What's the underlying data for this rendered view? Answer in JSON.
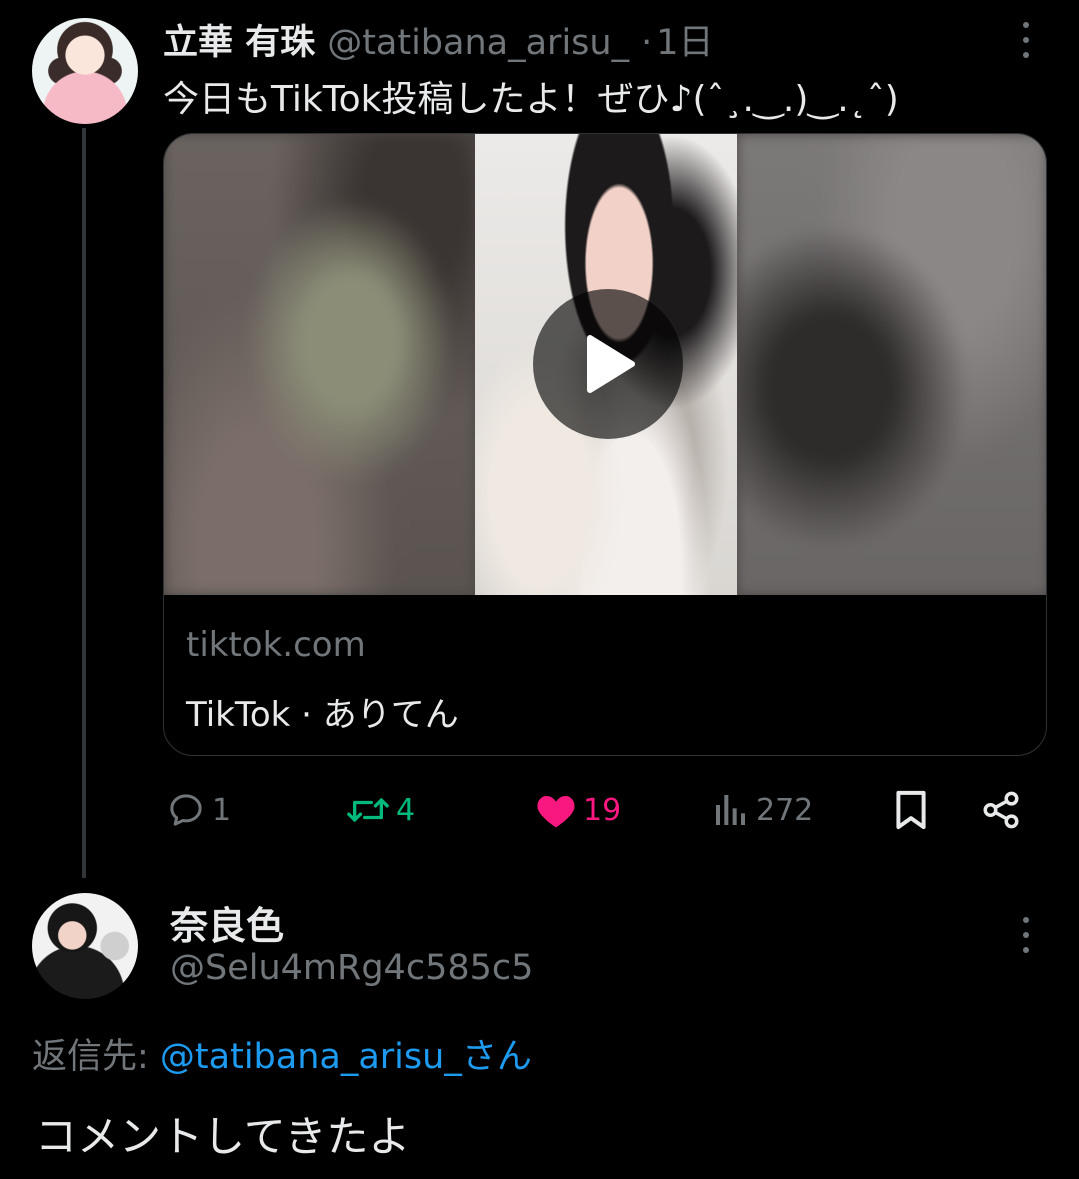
{
  "tweet": {
    "author_name": "立華 有珠",
    "author_handle": "@tatibana_arisu_",
    "separator": "·",
    "time": "1日",
    "text": "今日もTikTok投稿したよ！ぜひ♪(ˆ¸.‿.)‿.˛ˆ)",
    "card": {
      "domain": "tiktok.com",
      "title": "TikTok · ありてん"
    },
    "actions": {
      "replies": "1",
      "retweets": "4",
      "likes": "19",
      "views": "272"
    }
  },
  "reply": {
    "author_name": "奈良色",
    "author_handle": "@Selu4mRg4c585c5",
    "replying_prefix": "返信先: ",
    "replying_to": "@tatibana_arisu_さん",
    "text": "コメントしてきたよ"
  },
  "colors": {
    "background": "#000000",
    "text_primary": "#e7e9ea",
    "text_secondary": "#71767b",
    "retweet": "#00ba7c",
    "like": "#f91880",
    "link": "#1d9bf0"
  }
}
